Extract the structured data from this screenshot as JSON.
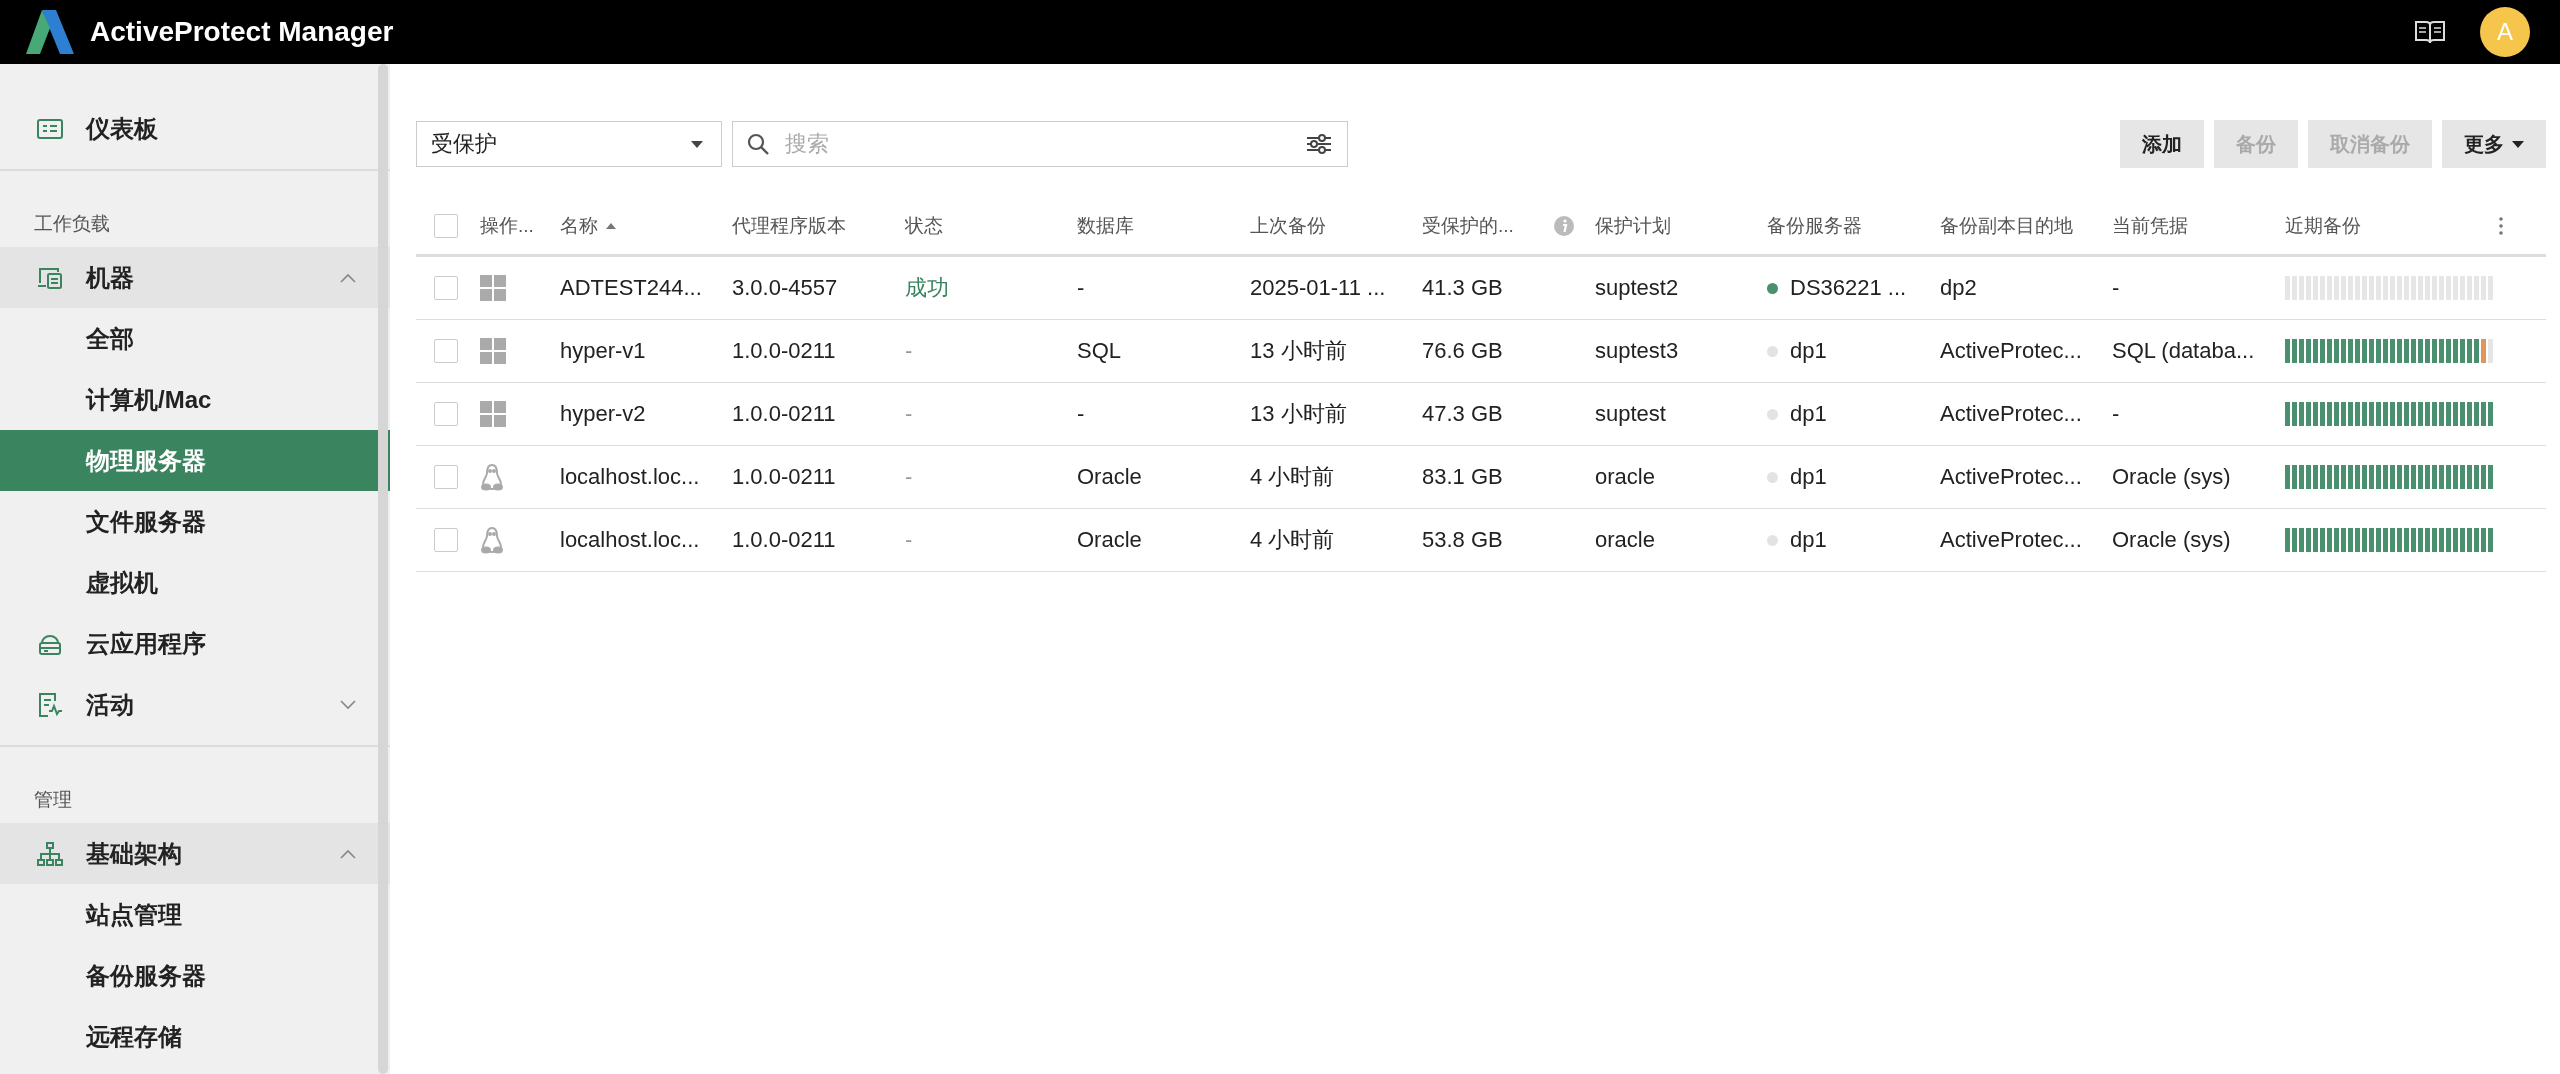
{
  "header": {
    "title": "ActiveProtect Manager",
    "avatar": "A"
  },
  "sidebar": {
    "sections": [
      {
        "items": [
          {
            "kind": "link",
            "label": "仪表板",
            "selected": false
          }
        ]
      },
      {
        "heading": "工作负载",
        "items": [
          {
            "kind": "group",
            "label": "机器",
            "expanded": true,
            "selected": false,
            "children": [
              {
                "label": "全部",
                "selected": false
              },
              {
                "label": "计算机/Mac",
                "selected": false
              },
              {
                "label": "物理服务器",
                "selected": true
              },
              {
                "label": "文件服务器",
                "selected": false
              },
              {
                "label": "虚拟机",
                "selected": false
              }
            ]
          },
          {
            "kind": "link",
            "label": "云应用程序",
            "selected": false
          },
          {
            "kind": "group",
            "label": "活动",
            "expanded": false,
            "selected": false
          }
        ]
      },
      {
        "heading": "管理",
        "items": [
          {
            "kind": "group",
            "label": "基础架构",
            "expanded": true,
            "selected": false,
            "children": [
              {
                "label": "站点管理",
                "selected": false
              },
              {
                "label": "备份服务器",
                "selected": false
              },
              {
                "label": "远程存储",
                "selected": false
              }
            ]
          }
        ]
      }
    ]
  },
  "toolbar": {
    "filter": "受保护",
    "search": {
      "placeholder": "搜索"
    },
    "buttons": [
      {
        "label": "添加",
        "kind": "plain",
        "disabled": false
      },
      {
        "label": "备份",
        "kind": "plain",
        "disabled": true
      },
      {
        "label": "取消备份",
        "kind": "plain",
        "disabled": true
      },
      {
        "label": "更多",
        "kind": "menu",
        "disabled": false
      }
    ]
  },
  "table": {
    "all_checked": false,
    "columns": [
      {
        "label": "操作...",
        "sorted": false
      },
      {
        "label": "名称",
        "sorted": true
      },
      {
        "label": "代理程序版本",
        "sorted": false
      },
      {
        "label": "状态",
        "sorted": false
      },
      {
        "label": "数据库",
        "sorted": false
      },
      {
        "label": "上次备份",
        "sorted": false
      },
      {
        "label": "受保护的...",
        "sorted": false,
        "info": true
      },
      {
        "label": "保护计划",
        "sorted": false
      },
      {
        "label": "备份服务器",
        "sorted": false
      },
      {
        "label": "备份副本目的地",
        "sorted": false
      },
      {
        "label": "当前凭据",
        "sorted": false
      },
      {
        "label": "近期备份",
        "sorted": false
      }
    ],
    "rows": [
      {
        "checked": false,
        "kind": "windows",
        "name": "ADTEST244...",
        "version": "3.0.0-4557",
        "status": {
          "label": "成功",
          "success": true
        },
        "database": "-",
        "last_backup": "2025-01-11 ...",
        "size": "41.3 GB",
        "plan": "suptest2",
        "server": {
          "label": "DS36221 ...",
          "color": "#4a8f6e"
        },
        "destination": "dp2",
        "credential": "-",
        "recent_backups": [
          {
            "kind": "empty"
          },
          {
            "kind": "empty"
          },
          {
            "kind": "empty"
          },
          {
            "kind": "empty"
          },
          {
            "kind": "empty"
          },
          {
            "kind": "empty"
          },
          {
            "kind": "empty"
          },
          {
            "kind": "empty"
          },
          {
            "kind": "empty"
          },
          {
            "kind": "empty"
          },
          {
            "kind": "empty"
          },
          {
            "kind": "empty"
          },
          {
            "kind": "empty"
          },
          {
            "kind": "empty"
          },
          {
            "kind": "empty"
          },
          {
            "kind": "empty"
          },
          {
            "kind": "empty"
          },
          {
            "kind": "empty"
          },
          {
            "kind": "empty"
          },
          {
            "kind": "empty"
          },
          {
            "kind": "empty"
          },
          {
            "kind": "empty"
          },
          {
            "kind": "empty"
          },
          {
            "kind": "empty"
          },
          {
            "kind": "empty"
          },
          {
            "kind": "empty"
          },
          {
            "kind": "empty"
          },
          {
            "kind": "empty"
          },
          {
            "kind": "empty"
          },
          {
            "kind": "empty"
          }
        ]
      },
      {
        "checked": false,
        "kind": "windows",
        "name": "hyper-v1",
        "version": "1.0.0-0211",
        "status": {
          "label": "-",
          "success": false
        },
        "database": "SQL",
        "last_backup": "13 小时前",
        "size": "76.6 GB",
        "plan": "suptest3",
        "server": {
          "label": "dp1",
          "color": "#e3e3e3"
        },
        "destination": "ActiveProtec...",
        "credential": "SQL (databa...",
        "recent_backups": [
          {
            "kind": "success"
          },
          {
            "kind": "success"
          },
          {
            "kind": "success"
          },
          {
            "kind": "success"
          },
          {
            "kind": "success"
          },
          {
            "kind": "success"
          },
          {
            "kind": "success"
          },
          {
            "kind": "success"
          },
          {
            "kind": "success"
          },
          {
            "kind": "success"
          },
          {
            "kind": "success"
          },
          {
            "kind": "success"
          },
          {
            "kind": "success"
          },
          {
            "kind": "success"
          },
          {
            "kind": "success"
          },
          {
            "kind": "success"
          },
          {
            "kind": "success"
          },
          {
            "kind": "success"
          },
          {
            "kind": "success"
          },
          {
            "kind": "success"
          },
          {
            "kind": "success"
          },
          {
            "kind": "success"
          },
          {
            "kind": "success"
          },
          {
            "kind": "success"
          },
          {
            "kind": "success"
          },
          {
            "kind": "success"
          },
          {
            "kind": "success"
          },
          {
            "kind": "success"
          },
          {
            "kind": "warning"
          },
          {
            "kind": "empty"
          }
        ]
      },
      {
        "checked": false,
        "kind": "windows",
        "name": "hyper-v2",
        "version": "1.0.0-0211",
        "status": {
          "label": "-",
          "success": false
        },
        "database": "-",
        "last_backup": "13 小时前",
        "size": "47.3 GB",
        "plan": "suptest",
        "server": {
          "label": "dp1",
          "color": "#e3e3e3"
        },
        "destination": "ActiveProtec...",
        "credential": "-",
        "recent_backups": [
          {
            "kind": "success"
          },
          {
            "kind": "success"
          },
          {
            "kind": "success"
          },
          {
            "kind": "success"
          },
          {
            "kind": "success"
          },
          {
            "kind": "success"
          },
          {
            "kind": "success"
          },
          {
            "kind": "success"
          },
          {
            "kind": "success"
          },
          {
            "kind": "success"
          },
          {
            "kind": "success"
          },
          {
            "kind": "success"
          },
          {
            "kind": "success"
          },
          {
            "kind": "success"
          },
          {
            "kind": "success"
          },
          {
            "kind": "success"
          },
          {
            "kind": "success"
          },
          {
            "kind": "success"
          },
          {
            "kind": "success"
          },
          {
            "kind": "success"
          },
          {
            "kind": "success"
          },
          {
            "kind": "success"
          },
          {
            "kind": "success"
          },
          {
            "kind": "success"
          },
          {
            "kind": "success"
          },
          {
            "kind": "success"
          },
          {
            "kind": "success"
          },
          {
            "kind": "success"
          },
          {
            "kind": "success"
          },
          {
            "kind": "success"
          }
        ]
      },
      {
        "checked": false,
        "kind": "linux",
        "name": "localhost.loc...",
        "version": "1.0.0-0211",
        "status": {
          "label": "-",
          "success": false
        },
        "database": "Oracle",
        "last_backup": "4 小时前",
        "size": "83.1 GB",
        "plan": "oracle",
        "server": {
          "label": "dp1",
          "color": "#e3e3e3"
        },
        "destination": "ActiveProtec...",
        "credential": "Oracle (sys)",
        "recent_backups": [
          {
            "kind": "success"
          },
          {
            "kind": "success"
          },
          {
            "kind": "success"
          },
          {
            "kind": "success"
          },
          {
            "kind": "success"
          },
          {
            "kind": "success"
          },
          {
            "kind": "success"
          },
          {
            "kind": "success"
          },
          {
            "kind": "success"
          },
          {
            "kind": "success"
          },
          {
            "kind": "success"
          },
          {
            "kind": "success"
          },
          {
            "kind": "success"
          },
          {
            "kind": "success"
          },
          {
            "kind": "success"
          },
          {
            "kind": "success"
          },
          {
            "kind": "success"
          },
          {
            "kind": "success"
          },
          {
            "kind": "success"
          },
          {
            "kind": "success"
          },
          {
            "kind": "success"
          },
          {
            "kind": "success"
          },
          {
            "kind": "success"
          },
          {
            "kind": "success"
          },
          {
            "kind": "success"
          },
          {
            "kind": "success"
          },
          {
            "kind": "success"
          },
          {
            "kind": "success"
          },
          {
            "kind": "success"
          },
          {
            "kind": "success"
          }
        ]
      },
      {
        "checked": false,
        "kind": "linux",
        "name": "localhost.loc...",
        "version": "1.0.0-0211",
        "status": {
          "label": "-",
          "success": false
        },
        "database": "Oracle",
        "last_backup": "4 小时前",
        "size": "53.8 GB",
        "plan": "oracle",
        "server": {
          "label": "dp1",
          "color": "#e3e3e3"
        },
        "destination": "ActiveProtec...",
        "credential": "Oracle (sys)",
        "recent_backups": [
          {
            "kind": "success"
          },
          {
            "kind": "success"
          },
          {
            "kind": "success"
          },
          {
            "kind": "success"
          },
          {
            "kind": "success"
          },
          {
            "kind": "success"
          },
          {
            "kind": "success"
          },
          {
            "kind": "success"
          },
          {
            "kind": "success"
          },
          {
            "kind": "success"
          },
          {
            "kind": "success"
          },
          {
            "kind": "success"
          },
          {
            "kind": "success"
          },
          {
            "kind": "success"
          },
          {
            "kind": "success"
          },
          {
            "kind": "success"
          },
          {
            "kind": "success"
          },
          {
            "kind": "success"
          },
          {
            "kind": "success"
          },
          {
            "kind": "success"
          },
          {
            "kind": "success"
          },
          {
            "kind": "success"
          },
          {
            "kind": "success"
          },
          {
            "kind": "success"
          },
          {
            "kind": "success"
          },
          {
            "kind": "success"
          },
          {
            "kind": "success"
          },
          {
            "kind": "success"
          },
          {
            "kind": "success"
          },
          {
            "kind": "success"
          }
        ]
      }
    ]
  }
}
